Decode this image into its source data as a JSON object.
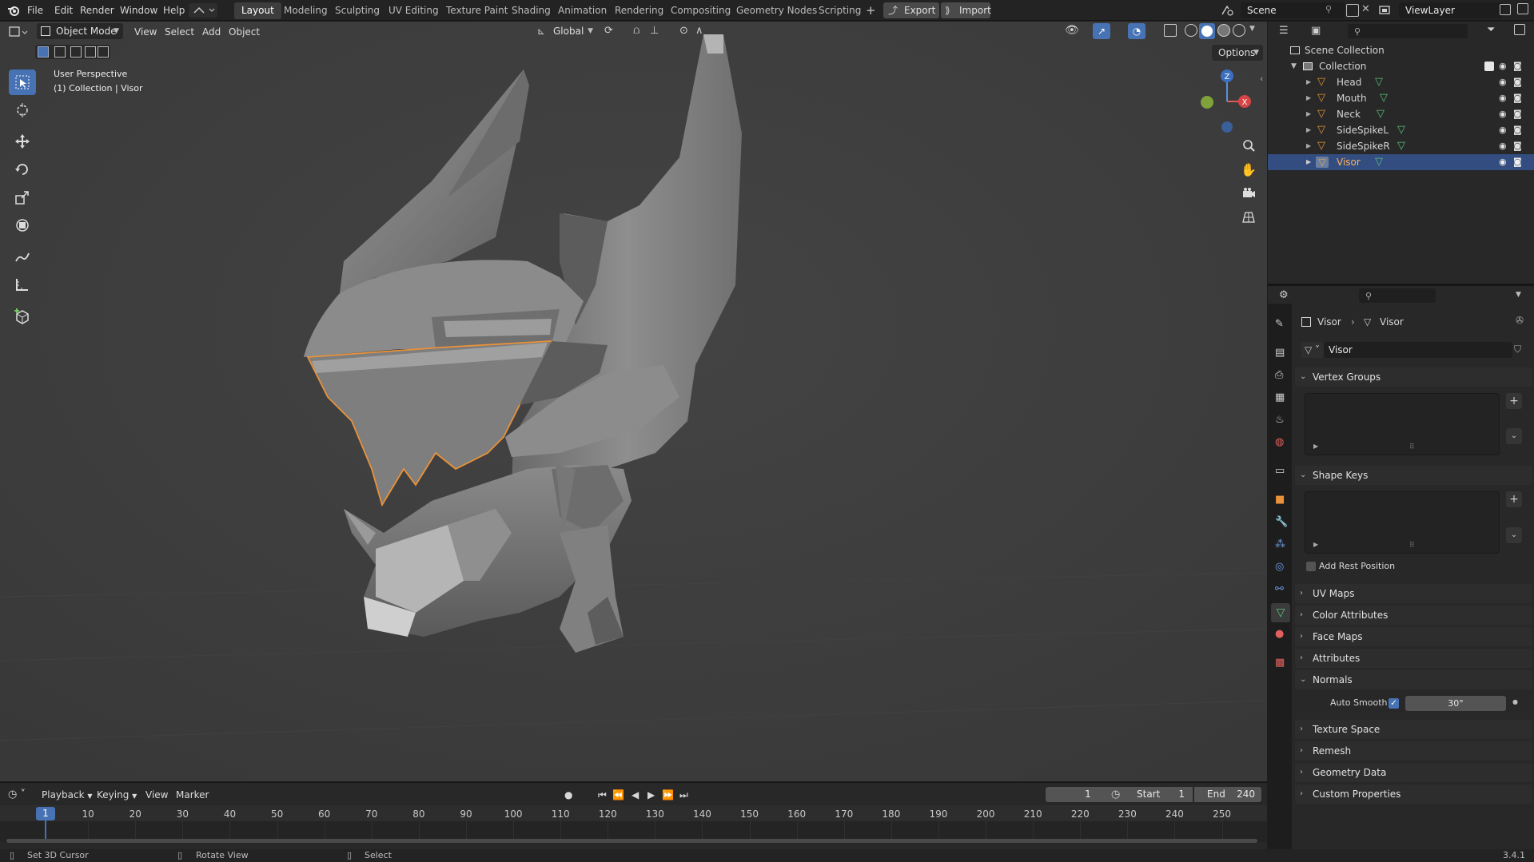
{
  "topbar": {
    "menus": [
      "File",
      "Edit",
      "Render",
      "Window",
      "Help"
    ],
    "workspaces": [
      "Layout",
      "Modeling",
      "Sculpting",
      "UV Editing",
      "Texture Paint",
      "Shading",
      "Animation",
      "Rendering",
      "Compositing",
      "Geometry Nodes",
      "Scripting"
    ],
    "active_workspace": "Layout",
    "export_label": "Export",
    "import_label": "Import",
    "scene": "Scene",
    "view_layer": "ViewLayer"
  },
  "viewport": {
    "mode": "Object Mode",
    "menus": [
      "View",
      "Select",
      "Add",
      "Object"
    ],
    "orientation": "Global",
    "options_label": "Options",
    "overlay_line1": "User Perspective",
    "overlay_line2": "(1) Collection | Visor",
    "gizmo_z": "Z",
    "gizmo_x": "X"
  },
  "outliner": {
    "root": "Scene Collection",
    "collection": "Collection",
    "items": [
      {
        "name": "Head"
      },
      {
        "name": "Mouth"
      },
      {
        "name": "Neck"
      },
      {
        "name": "SideSpikeL"
      },
      {
        "name": "SideSpikeR"
      },
      {
        "name": "Visor",
        "selected": true
      }
    ]
  },
  "properties": {
    "breadcrumb_object": "Visor",
    "breadcrumb_data": "Visor",
    "mesh_name": "Visor",
    "panels": {
      "vertex_groups": "Vertex Groups",
      "shape_keys": "Shape Keys",
      "add_rest_position": "Add Rest Position",
      "uv_maps": "UV Maps",
      "color_attributes": "Color Attributes",
      "face_maps": "Face Maps",
      "attributes": "Attributes",
      "normals": "Normals",
      "auto_smooth_label": "Auto Smooth",
      "auto_smooth_angle": "30°",
      "texture_space": "Texture Space",
      "remesh": "Remesh",
      "geometry_data": "Geometry Data",
      "custom_properties": "Custom Properties"
    }
  },
  "timeline": {
    "menus": [
      "Playback",
      "Keying",
      "View",
      "Marker"
    ],
    "current_frame": "1",
    "start_label": "Start",
    "start": "1",
    "end_label": "End",
    "end": "240",
    "ticks": [
      "1",
      "10",
      "20",
      "30",
      "40",
      "50",
      "60",
      "70",
      "80",
      "90",
      "100",
      "110",
      "120",
      "130",
      "140",
      "150",
      "160",
      "170",
      "180",
      "190",
      "200",
      "210",
      "220",
      "230",
      "240",
      "250"
    ]
  },
  "statusbar": {
    "hint1": "Set 3D Cursor",
    "hint2": "Rotate View",
    "hint3": "Select",
    "version": "3.4.1"
  },
  "colors": {
    "accent": "#4772b3",
    "selection_outline": "#e8923a",
    "outliner_selected": "#334d80",
    "mesh_icon": "#e8923a",
    "data_icon": "#58c07a"
  }
}
